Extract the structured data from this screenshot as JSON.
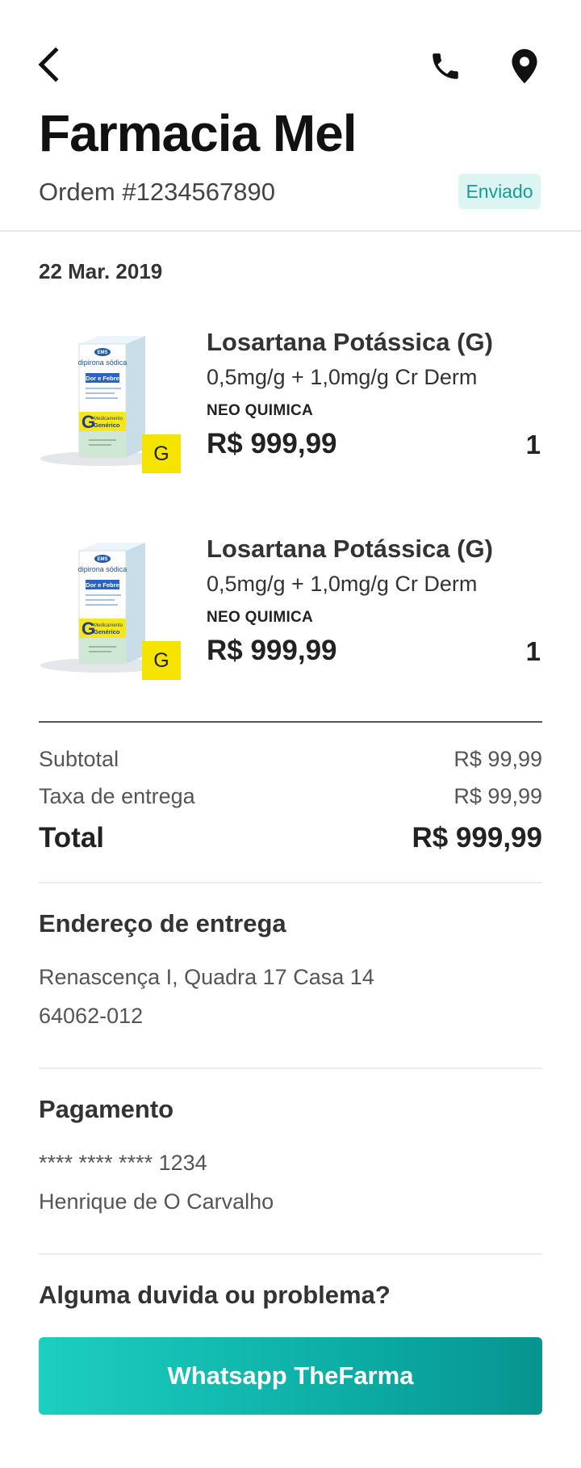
{
  "header": {
    "store_name": "Farmacia Mel",
    "order_number": "Ordem #1234567890",
    "status": "Enviado",
    "icons": {
      "back": "back-arrow-icon",
      "phone": "phone-icon",
      "location": "location-pin-icon"
    }
  },
  "order": {
    "date": "22 Mar. 2019",
    "items": [
      {
        "name": "Losartana Potássica (G)",
        "dose": "0,5mg/g + 1,0mg/g Cr Derm",
        "brand": "NEO QUIMICA",
        "price": "R$ 999,99",
        "quantity": "1",
        "badge": "G",
        "box": {
          "brand_mark": "EMS",
          "product": "dipirona sódica",
          "banner": "Dor e Febre",
          "line1": "Medicamento",
          "line2": "Genérico"
        }
      },
      {
        "name": "Losartana Potássica (G)",
        "dose": "0,5mg/g + 1,0mg/g Cr Derm",
        "brand": "NEO QUIMICA",
        "price": "R$ 999,99",
        "quantity": "1",
        "badge": "G",
        "box": {
          "brand_mark": "EMS",
          "product": "dipirona sódica",
          "banner": "Dor e Febre",
          "line1": "Medicamento",
          "line2": "Genérico"
        }
      }
    ]
  },
  "summary": {
    "subtotal_label": "Subtotal",
    "subtotal_value": "R$ 99,99",
    "delivery_label": "Taxa de entrega",
    "delivery_value": "R$ 99,99",
    "total_label": "Total",
    "total_value": "R$ 999,99"
  },
  "delivery": {
    "title": "Endereço de entrega",
    "address_line1": "Renascença I, Quadra 17 Casa 14",
    "address_line2": "64062-012"
  },
  "payment": {
    "title": "Pagamento",
    "card": "**** **** **** 1234",
    "holder": "Henrique de O Carvalho"
  },
  "help": {
    "title": "Alguma duvida ou problema?",
    "button_label": "Whatsapp TheFarma"
  },
  "colors": {
    "accent": "#1ccfbf",
    "accent_dark": "#08948f",
    "status_bg": "#dcf4f2",
    "status_text": "#139e94",
    "generic_yellow": "#f5e400"
  }
}
